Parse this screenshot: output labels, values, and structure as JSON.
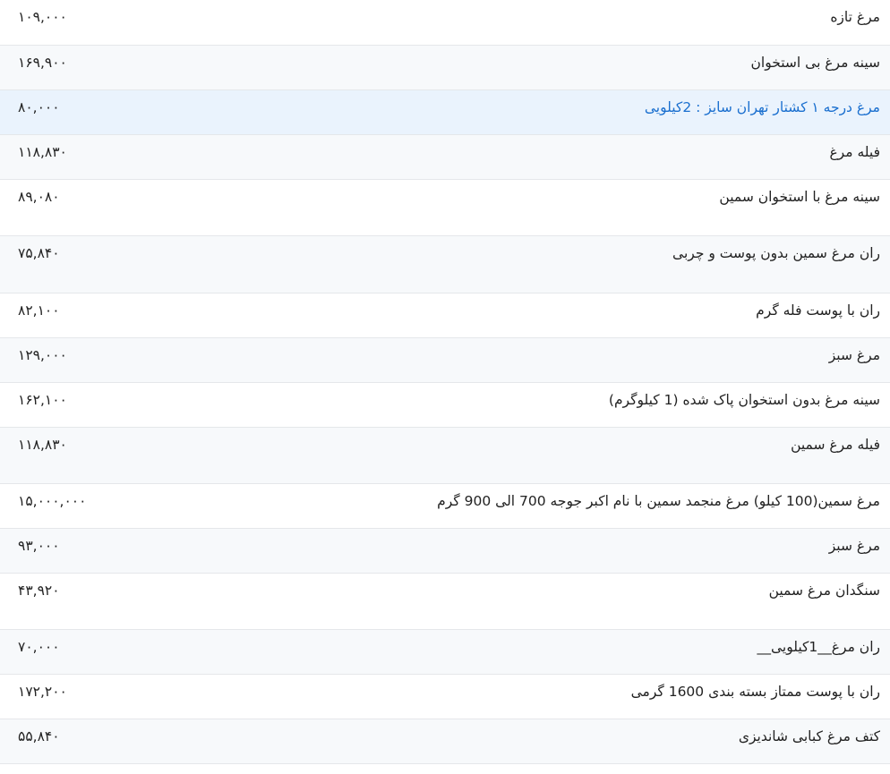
{
  "price_list": {
    "rows": [
      {
        "name": "مرغ تازه",
        "price": "۱۰۹,۰۰۰"
      },
      {
        "name": "سینه مرغ بی استخوان",
        "price": "۱۶۹,۹۰۰"
      },
      {
        "name": "مرغ درجه ۱ کشتار تهران سایز : 2کیلویی",
        "price": "۸۰,۰۰۰"
      },
      {
        "name": "فیله مرغ",
        "price": "۱۱۸,۸۳۰"
      },
      {
        "name": "سینه مرغ با استخوان سمین",
        "price": "۸۹,۰۸۰"
      },
      {
        "name": "ران مرغ سمین بدون پوست و چربی",
        "price": "۷۵,۸۴۰"
      },
      {
        "name": "ران با پوست فله گرم",
        "price": "۸۲,۱۰۰"
      },
      {
        "name": "مرغ سبز",
        "price": "۱۲۹,۰۰۰"
      },
      {
        "name": "سینه مرغ بدون استخوان پاک شده (1 کیلوگرم)",
        "price": "۱۶۲,۱۰۰"
      },
      {
        "name": "فیله مرغ سمین",
        "price": "۱۱۸,۸۳۰"
      },
      {
        "name": "مرغ سمین(100 کیلو) مرغ منجمد سمین با نام اکبر جوجه 700 الی 900 گرم",
        "price": "۱۵,۰۰۰,۰۰۰"
      },
      {
        "name": "مرغ سبز",
        "price": "۹۳,۰۰۰"
      },
      {
        "name": "سنگدان مرغ سمین",
        "price": "۴۳,۹۲۰"
      },
      {
        "name": "ران مرغ__1کیلویی__",
        "price": "۷۰,۰۰۰"
      },
      {
        "name": "ران با پوست ممتاز بسته بندی 1600 گرمی",
        "price": "۱۷۲,۲۰۰"
      },
      {
        "name": "کتف مرغ کبابی شاندیزی",
        "price": "۵۵,۸۴۰"
      }
    ]
  },
  "colors": {
    "link_blue": "#1a6fcf",
    "row_alt": "#f7f9fb",
    "row_highlight": "#eaf3fd",
    "divider": "#e5e7ea"
  }
}
